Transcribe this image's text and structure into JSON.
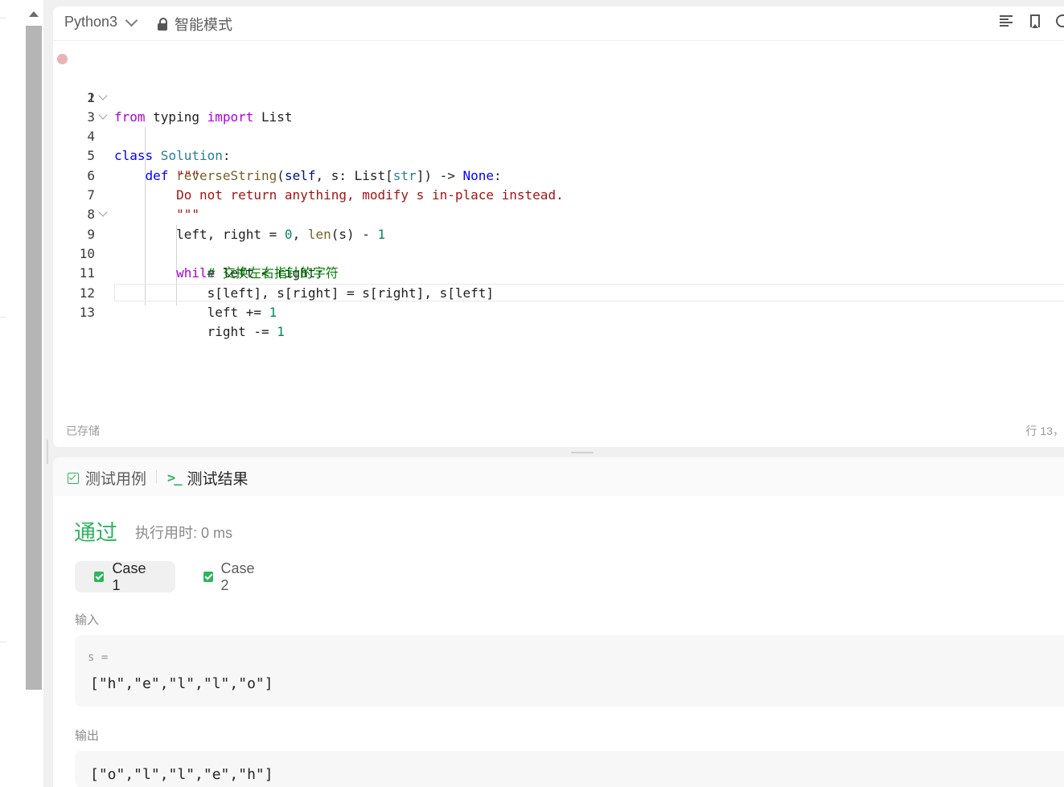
{
  "editor": {
    "language": "Python3",
    "mode": "智能模式",
    "status": "已存储",
    "cursor_position": "行 13，"
  },
  "code": {
    "line_numbers": [
      "1",
      "2",
      "3",
      "4",
      "5",
      "6",
      "7",
      "8",
      "9",
      "10",
      "11",
      "12",
      "13"
    ],
    "l1": {
      "kw1": "from",
      "mod": " typing ",
      "kw2": "import",
      "name": " List"
    },
    "l3": {
      "kw": "class",
      "cls": " Solution",
      "rest": ":"
    },
    "l4": {
      "kw": "def",
      "fn": " reverseString",
      "p1": "(",
      "self": "self",
      "p2": ", s: List[",
      "type": "str",
      "p3": "]) -> ",
      "none": "None",
      "p4": ":"
    },
    "l5": "\"\"\"",
    "l6": "Do not return anything, modify s in-place instead.",
    "l7": "\"\"\"",
    "l8": {
      "a": "left, right = ",
      "n0": "0",
      "b": ", ",
      "len": "len",
      "c": "(s) - ",
      "n1": "1"
    },
    "l9": {
      "kw": "while",
      "rest": " left < right:"
    },
    "l10": "# 交换左右指针的字符",
    "l11": "s[left], s[right] = s[right], s[left]",
    "l12": {
      "a": "left += ",
      "n": "1"
    },
    "l13": {
      "a": "right -= ",
      "n": "1"
    }
  },
  "result": {
    "tabs": {
      "cases": "测试用例",
      "results": "测试结果"
    },
    "verdict": "通过",
    "runtime": "执行用时: 0 ms",
    "case_labels": [
      "Case 1",
      "Case 2"
    ],
    "input_label": "输入",
    "input_var": "s =",
    "input_value": "[\"h\",\"e\",\"l\",\"l\",\"o\"]",
    "output_label": "输出",
    "output_value": "[\"o\",\"l\",\"l\",\"e\",\"h\"]"
  },
  "colors": {
    "accent_green": "#2db55d",
    "keyword_blue": "#0000ff",
    "keyword_purple": "#af00db",
    "string_red": "#a31515",
    "comment_green": "#008000",
    "number_green": "#098658"
  }
}
